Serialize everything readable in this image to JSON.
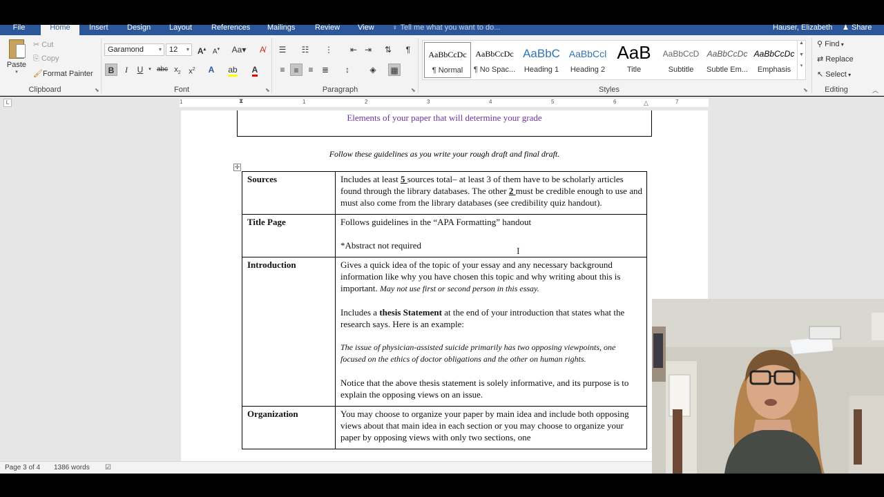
{
  "tabs": {
    "file": "File",
    "home": "Home",
    "insert": "Insert",
    "design": "Design",
    "layout": "Layout",
    "references": "References",
    "mailings": "Mailings",
    "review": "Review",
    "view": "View"
  },
  "tell_me": "Tell me what you want to do...",
  "user_name": "Hauser, Elizabeth",
  "share": "Share",
  "clipboard": {
    "paste": "Paste",
    "cut": "Cut",
    "copy": "Copy",
    "format_painter": "Format Painter",
    "label": "Clipboard"
  },
  "font": {
    "name": "Garamond",
    "size": "12",
    "label": "Font"
  },
  "paragraph": {
    "label": "Paragraph"
  },
  "styles": {
    "label": "Styles",
    "items": [
      {
        "preview": "AaBbCcDc",
        "name": "¶ Normal"
      },
      {
        "preview": "AaBbCcDc",
        "name": "¶ No Spac..."
      },
      {
        "preview": "AaBbC",
        "name": "Heading 1"
      },
      {
        "preview": "AaBbCcl",
        "name": "Heading 2"
      },
      {
        "preview": "AaB",
        "name": "Title"
      },
      {
        "preview": "AaBbCcD",
        "name": "Subtitle"
      },
      {
        "preview": "AaBbCcDc",
        "name": "Subtle Em..."
      },
      {
        "preview": "AaBbCcDc",
        "name": "Emphasis"
      }
    ]
  },
  "editing": {
    "find": "Find",
    "replace": "Replace",
    "select": "Select",
    "label": "Editing"
  },
  "ruler_numbers": [
    "1",
    "1",
    "2",
    "3",
    "4",
    "5",
    "6",
    "7"
  ],
  "document": {
    "box_title": "Elements of your paper that will determine your grade",
    "guideline": "Follow these guidelines as you write your rough draft and final draft.",
    "rows": [
      {
        "label": "Sources",
        "p1_a": "Includes at least ",
        "p1_u1": "5 ",
        "p1_b": "sources total– at least 3 of them have to be scholarly articles found through the library databases. The other ",
        "p1_u2": "2 ",
        "p1_c": "must be credible enough to use and must also come from the library databases (see credibility quiz handout)."
      },
      {
        "label": "Title Page",
        "p1": "Follows guidelines in the “APA Formatting” handout",
        "p2": "*Abstract not required"
      },
      {
        "label": "Introduction",
        "p1_a": "Gives a quick idea of the topic of your essay and any necessary background information like why you have chosen this topic and why writing about this is important. ",
        "p1_i": "May not use first or second person in this essay.",
        "p2_a": "Includes a ",
        "p2_b": "thesis Statement",
        "p2_c": " at the end of your introduction that states what the research says. Here is an example:",
        "p3": "The issue of physician-assisted suicide primarily has two opposing viewpoints, one focused on the ethics of doctor obligations and the other on human rights.",
        "p4": "Notice that the above thesis statement is solely informative, and its purpose is to explain the opposing views on an issue."
      },
      {
        "label": "Organization",
        "p1": "You may choose to organize your paper by main idea and include both opposing views about that main idea in each section or you may choose to organize your paper by opposing views with only two sections, one"
      }
    ]
  },
  "status": {
    "page": "Page 3 of 4",
    "words": "1386 words"
  }
}
